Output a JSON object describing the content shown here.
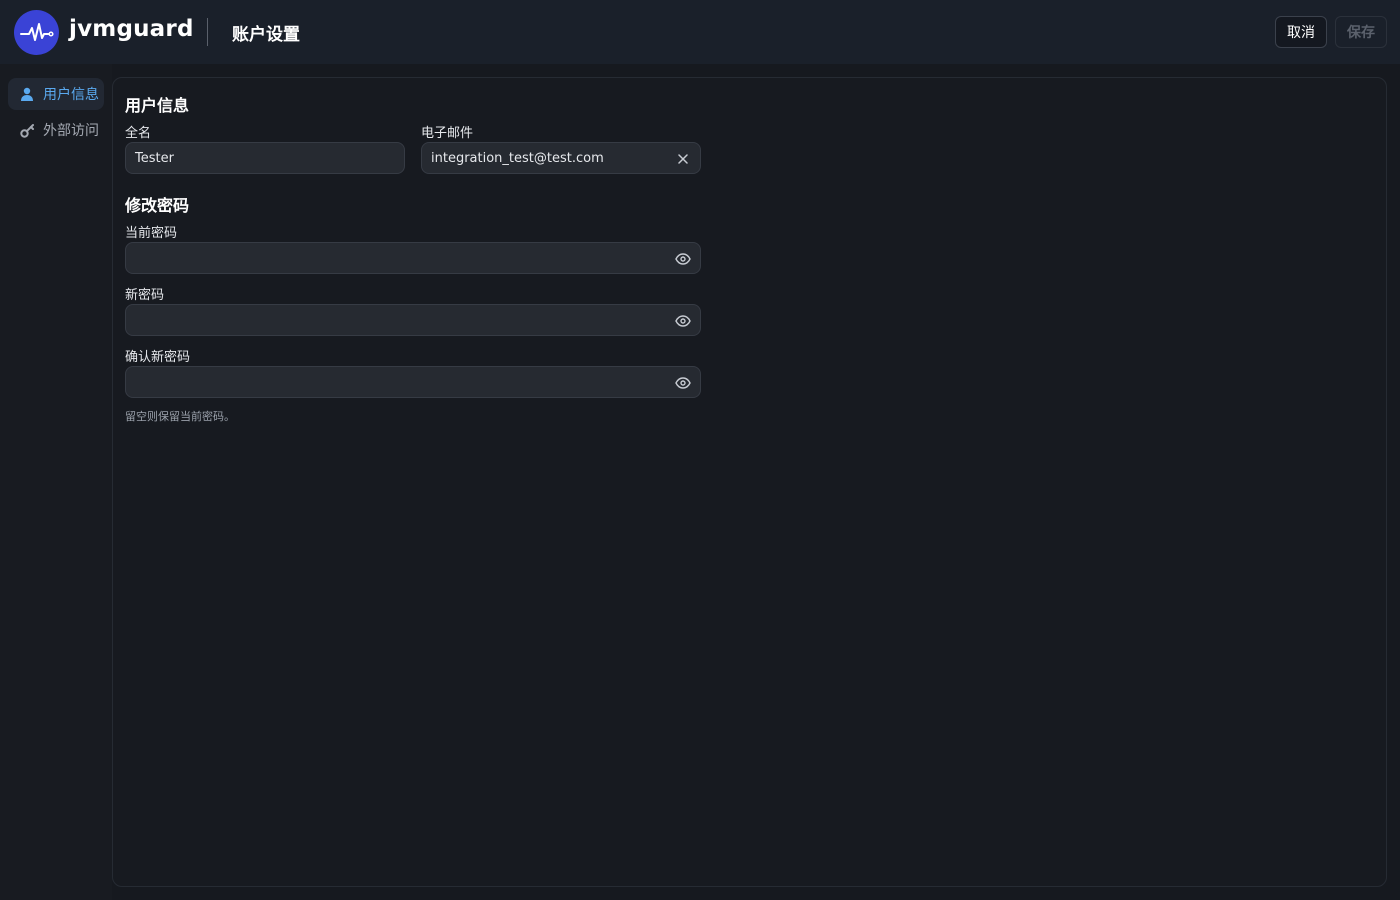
{
  "header": {
    "brand": "jvmguard",
    "page_title": "账户设置",
    "cancel_label": "取消",
    "save_label": "保存",
    "logo_icon": "pulse-icon"
  },
  "sidebar": {
    "items": [
      {
        "label": "用户信息",
        "icon": "user-icon",
        "active": true
      },
      {
        "label": "外部访问",
        "icon": "key-icon",
        "active": false
      }
    ]
  },
  "user_info": {
    "title": "用户信息",
    "full_name_label": "全名",
    "full_name_value": "Tester",
    "email_label": "电子邮件",
    "email_value": "integration_test@test.com"
  },
  "password": {
    "title": "修改密码",
    "current_label": "当前密码",
    "new_label": "新密码",
    "confirm_label": "确认新密码",
    "hint": "留空则保留当前密码。"
  },
  "colors": {
    "accent": "#3a43d6",
    "active_nav": "#5aa9ef",
    "background": "#16191f"
  }
}
